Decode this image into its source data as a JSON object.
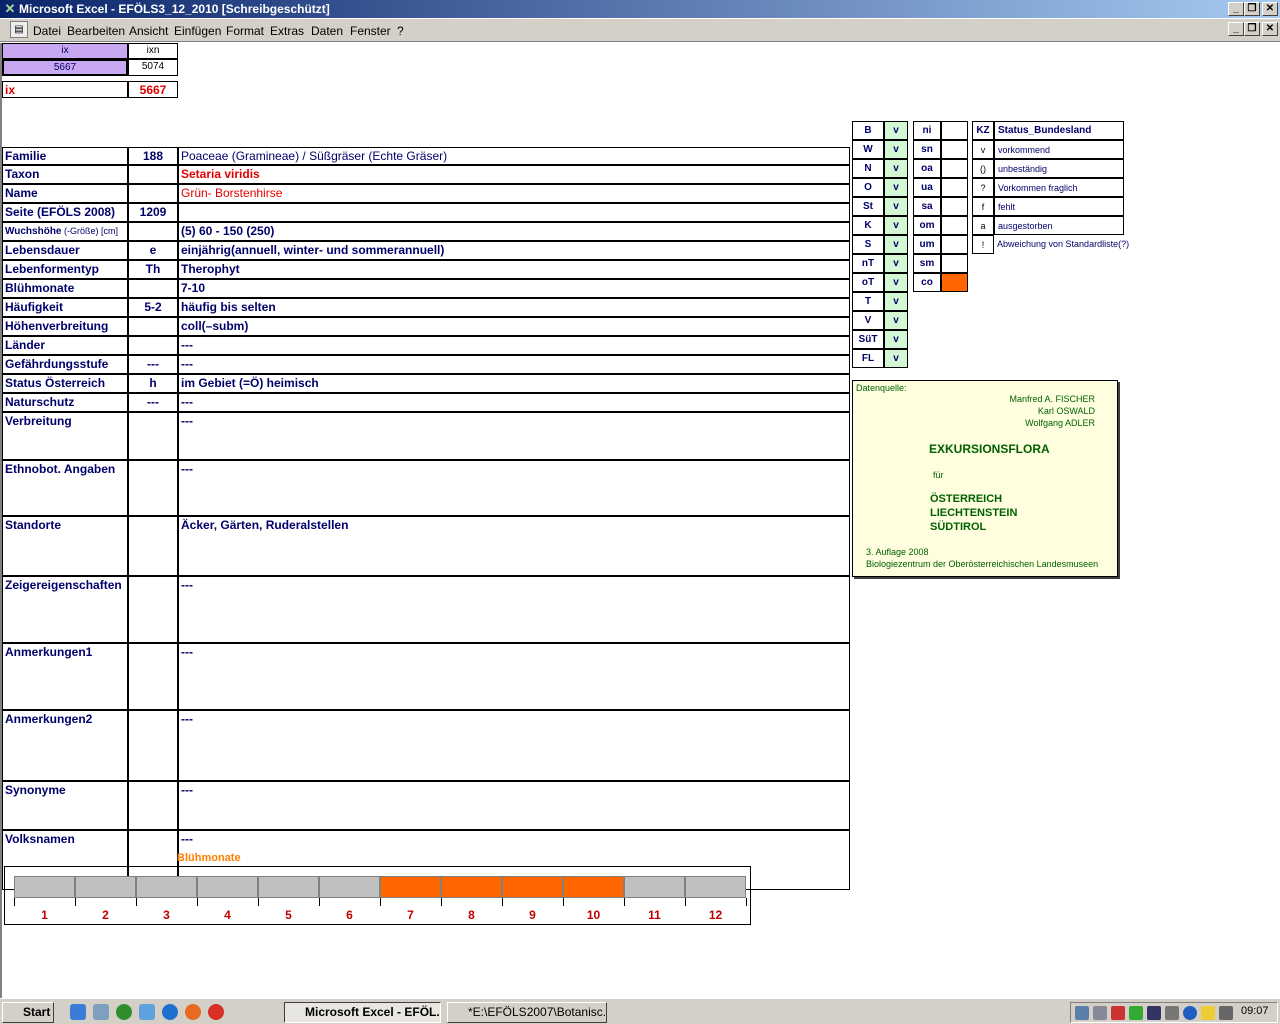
{
  "window": {
    "title": "Microsoft Excel - EFÖLS3_12_2010  [Schreibgeschützt]"
  },
  "menu": [
    "Datei",
    "Bearbeiten",
    "Ansicht",
    "Einfügen",
    "Format",
    "Extras",
    "Daten",
    "Fenster",
    "?"
  ],
  "index": {
    "ix_label": "ix",
    "ixn_label": "ixn",
    "ix_value": "5667",
    "ixn_value": "5074",
    "ix2_label": "ix",
    "ix2_value": "5667"
  },
  "fields": [
    {
      "label": "Familie",
      "code": "188",
      "value": "Poaceae (Gramineae)  /  Süßgräser (Echte Gräser)"
    },
    {
      "label": "Taxon",
      "code": "",
      "value": "Setaria viridis"
    },
    {
      "label": "Name",
      "code": "",
      "value": "Grün- Borstenhirse"
    },
    {
      "label": "Seite (EFÖLS 2008)",
      "code": "1209",
      "value": ""
    },
    {
      "label": "Wuchshöhe",
      "label_suffix": " (-Größe) [cm]",
      "code": "",
      "value": " (5) 60 - 150 (250)"
    },
    {
      "label": "Lebensdauer",
      "code": "e",
      "value": "einjährig(annuell, winter- und sommerannuell)"
    },
    {
      "label": "Lebenformentyp",
      "code": "Th",
      "value": "Therophyt"
    },
    {
      "label": "Blühmonate",
      "code": "",
      "value": " 7-10"
    },
    {
      "label": "Häufigkeit",
      "code": "5-2",
      "value": "häufig bis selten"
    },
    {
      "label": "Höhenverbreitung",
      "code": "",
      "value": "coll(–subm)"
    },
    {
      "label": "Länder",
      "code": "",
      "value": " ---"
    },
    {
      "label": "Gefährdungsstufe",
      "code": "---",
      "value": "  ---"
    },
    {
      "label": "Status Österreich",
      "code": "h",
      "value": "im Gebiet (=Ö) heimisch"
    },
    {
      "label": "Naturschutz",
      "code": "---",
      "value": " ---"
    },
    {
      "label": "Verbreitung",
      "code": "",
      "value": " ---"
    },
    {
      "label": "Ethnobot. Angaben",
      "code": "",
      "value": "---"
    },
    {
      "label": "Standorte",
      "code": "",
      "value": "Äcker, Gärten, Ruderalstellen"
    },
    {
      "label": "Zeigereigenschaften",
      "code": "",
      "value": "---"
    },
    {
      "label": "Anmerkungen1",
      "code": "",
      "value": "---"
    },
    {
      "label": "Anmerkungen2",
      "code": "",
      "value": "---"
    },
    {
      "label": "Synonyme",
      "code": "",
      "value": "---"
    },
    {
      "label": "Volksnamen",
      "code": "",
      "value": "---"
    }
  ],
  "states": [
    {
      "code": "B",
      "v": "v"
    },
    {
      "code": "W",
      "v": "v"
    },
    {
      "code": "N",
      "v": "v"
    },
    {
      "code": "O",
      "v": "v"
    },
    {
      "code": "St",
      "v": "v"
    },
    {
      "code": "K",
      "v": "v"
    },
    {
      "code": "S",
      "v": "v"
    },
    {
      "code": "nT",
      "v": "v"
    },
    {
      "code": "oT",
      "v": "v"
    },
    {
      "code": "T",
      "v": "v"
    },
    {
      "code": "V",
      "v": "v"
    },
    {
      "code": "SüT",
      "v": "v"
    },
    {
      "code": "FL",
      "v": "v"
    }
  ],
  "regions": [
    {
      "code": "ni",
      "v": ""
    },
    {
      "code": "sn",
      "v": ""
    },
    {
      "code": "oa",
      "v": ""
    },
    {
      "code": "ua",
      "v": ""
    },
    {
      "code": "sa",
      "v": ""
    },
    {
      "code": "om",
      "v": ""
    },
    {
      "code": "um",
      "v": ""
    },
    {
      "code": "sm",
      "v": ""
    },
    {
      "code": "co",
      "v": "",
      "highlight": true
    }
  ],
  "legend": {
    "header_kz": "KZ",
    "header_status": "Status_Bundesland",
    "rows": [
      {
        "kz": "v",
        "text": "vorkommend"
      },
      {
        "kz": "()",
        "text": "unbeständig"
      },
      {
        "kz": "?",
        "text": "Vorkommen fraglich"
      },
      {
        "kz": "f",
        "text": "fehlt"
      },
      {
        "kz": "a",
        "text": "ausgestorben"
      },
      {
        "kz": "!",
        "text": "Abweichung von Standardliste(?)"
      }
    ]
  },
  "source_note": {
    "label": "Datenquelle:",
    "author1": "Manfred A. FISCHER",
    "author2": "Karl OSWALD",
    "author3": "Wolfgang ADLER",
    "title": "EXKURSIONSFLORA",
    "fuer": "für",
    "land1": "ÖSTERREICH",
    "land2": "LIECHTENSTEIN",
    "land3": "SÜDTIROL",
    "edition": "3. Auflage 2008",
    "publisher": "Biologiezentrum der Oberösterreichischen Landesmuseen"
  },
  "bloom": {
    "title": "Blühmonate",
    "months": [
      "1",
      "2",
      "3",
      "4",
      "5",
      "6",
      "7",
      "8",
      "9",
      "10",
      "11",
      "12"
    ],
    "active": [
      7,
      8,
      9,
      10
    ],
    "colors": {
      "active": "#ff6600",
      "inactive": "#c0c0c0"
    }
  },
  "taskbar": {
    "start": "Start",
    "task1": "Microsoft Excel - EFÖL...",
    "task2": "*E:\\EFÖLS2007\\Botanisc...",
    "clock": "09:07"
  }
}
